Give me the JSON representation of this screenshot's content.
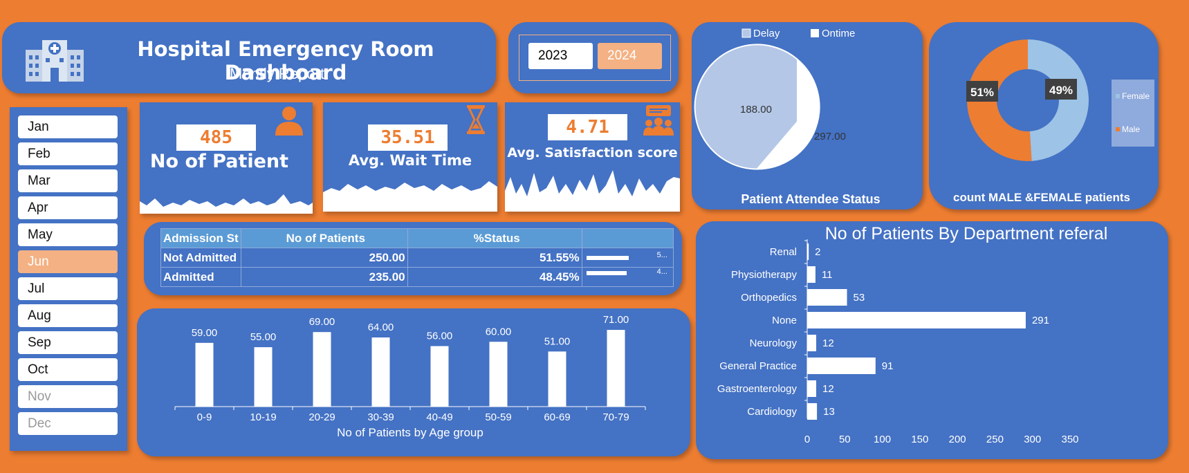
{
  "header": {
    "title": "Hospital Emergency Room Dashboard",
    "subtitle": "Montly Report"
  },
  "years": [
    "2023",
    "2024"
  ],
  "months": [
    "Jan",
    "Feb",
    "Mar",
    "Apr",
    "May",
    "Jun",
    "Jul",
    "Aug",
    "Sep",
    "Oct",
    "Nov",
    "Dec"
  ],
  "selected_month": "Jun",
  "kpis": [
    {
      "value": "485",
      "label": "No of Patient",
      "icon": "person-icon"
    },
    {
      "value": "35.51",
      "label": "Avg. Wait Time",
      "icon": "hourglass-icon"
    },
    {
      "value": "4.71",
      "label": "Avg. Satisfaction score",
      "icon": "feedback-group-icon"
    }
  ],
  "status_table": {
    "headers": [
      "Admission St",
      "No of Patients",
      "%Status"
    ],
    "rows": [
      {
        "label": "Not Admitted",
        "count": "250.00",
        "pct": "51.55%",
        "pct_value": 51.55,
        "spark_text": "5..."
      },
      {
        "label": "Admitted",
        "count": "235.00",
        "pct": "48.45%",
        "pct_value": 48.45,
        "spark_text": "4..."
      }
    ]
  },
  "colors": {
    "background": "#ED7D31",
    "panel": "#4472C4",
    "accent": "#F4B183",
    "light_blue": "#B4C7E7",
    "white": "#FFFFFF"
  },
  "chart_data": [
    {
      "type": "bar",
      "title": "",
      "categories": [
        "0-9",
        "10-19",
        "20-29",
        "30-39",
        "40-49",
        "50-59",
        "60-69",
        "70-79"
      ],
      "values": [
        59,
        55,
        69,
        64,
        56,
        60,
        51,
        71
      ],
      "labels": [
        "59.00",
        "55.00",
        "69.00",
        "64.00",
        "56.00",
        "60.00",
        "51.00",
        "71.00"
      ],
      "xlabel": "No of Patients by Age group",
      "ylim": [
        0,
        80
      ],
      "grid": false
    },
    {
      "type": "pie",
      "title": "Patient Attendee Status",
      "legend": [
        "Delay",
        "Ontime"
      ],
      "legend_position": "top",
      "series": [
        {
          "name": "Ontime",
          "value": 188,
          "label": "188.00",
          "color": "#FFFFFF"
        },
        {
          "name": "Delay",
          "value": 297,
          "label": "297.00",
          "color": "#B4C7E7"
        }
      ]
    },
    {
      "type": "pie",
      "title": "count MALE &FEMALE patients",
      "donut": true,
      "legend": [
        "Female",
        "Male"
      ],
      "legend_position": "right",
      "series": [
        {
          "name": "Female",
          "percent": 49,
          "label": "49%",
          "color": "#9DC3E6"
        },
        {
          "name": "Male",
          "percent": 51,
          "label": "51%",
          "color": "#ED7D31"
        }
      ]
    },
    {
      "type": "bar",
      "orientation": "horizontal",
      "title": "No of Patients By Department referal",
      "categories": [
        "Renal",
        "Physiotherapy",
        "Orthopedics",
        "None",
        "Neurology",
        "General Practice",
        "Gastroenterology",
        "Cardiology"
      ],
      "values": [
        2,
        11,
        53,
        291,
        12,
        91,
        12,
        13
      ],
      "xlim": [
        0,
        350
      ],
      "xticks": [
        0,
        50,
        100,
        150,
        200,
        250,
        300,
        350
      ],
      "grid": false
    }
  ]
}
